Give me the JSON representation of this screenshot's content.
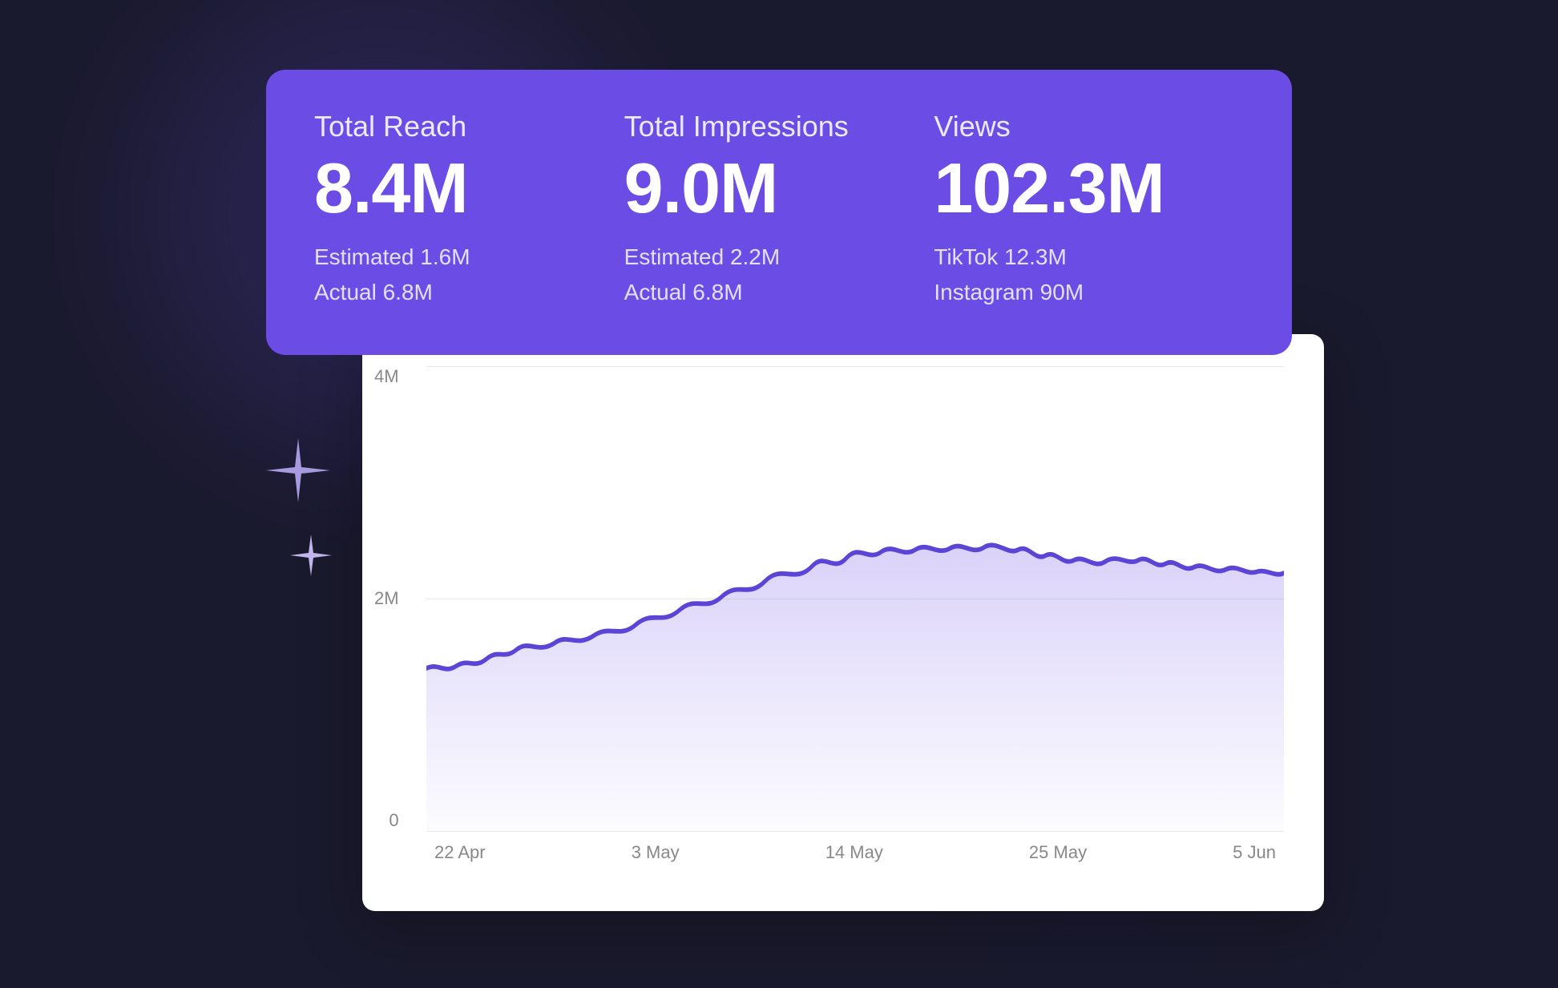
{
  "background": {
    "color": "#1a1a2e"
  },
  "stats_card": {
    "background": "#6b4de6",
    "blocks": [
      {
        "label": "Total Reach",
        "value": "8.4M",
        "sub_lines": [
          "Estimated 1.6M",
          "Actual 6.8M"
        ]
      },
      {
        "label": "Total Impressions",
        "value": "9.0M",
        "sub_lines": [
          "Estimated 2.2M",
          "Actual 6.8M"
        ]
      },
      {
        "label": "Views",
        "value": "102.3M",
        "sub_lines": [
          "TikTok 12.3M",
          "Instagram 90M"
        ]
      }
    ]
  },
  "chart": {
    "y_labels": [
      "4M",
      "2M",
      "0"
    ],
    "x_labels": [
      "22 Apr",
      "3 May",
      "14 May",
      "25 May",
      "5 Jun"
    ],
    "line_color": "#5b44d6",
    "fill_color": "rgba(107, 77, 230, 0.12)"
  },
  "sparkles": {
    "large": "✦",
    "small": "✦"
  }
}
